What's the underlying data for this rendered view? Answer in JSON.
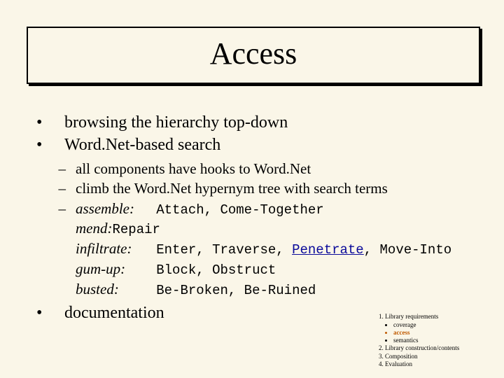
{
  "title": "Access",
  "bullets": {
    "b1": "browsing the hierarchy top-down",
    "b2": "Word.Net-based search",
    "b3": "documentation"
  },
  "sub": {
    "s1": "all components have hooks to Word.Net",
    "s2": "climb the Word.Net hypernym tree with search terms"
  },
  "examples": {
    "assemble": {
      "term": "assemble:",
      "vals": "Attach, Come-Together"
    },
    "mend": {
      "term": "mend: ",
      "vals": "Repair"
    },
    "infiltrate": {
      "term": "infiltrate:",
      "pre": "Enter, Traverse, ",
      "link": "Penetrate",
      "post": ", Move-Into"
    },
    "gumup": {
      "term": "gum-up:",
      "vals": "Block, Obstruct"
    },
    "busted": {
      "term": "busted:",
      "vals": "Be-Broken, Be-Ruined"
    }
  },
  "outline": {
    "o1": "Library requirements",
    "o1a": "coverage",
    "o1b": "access",
    "o1c": "semantics",
    "o2": "Library construction/contents",
    "o3": "Composition",
    "o4": "Evaluation"
  }
}
